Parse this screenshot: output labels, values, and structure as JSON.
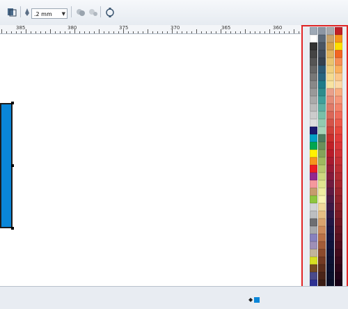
{
  "toolbar": {
    "outline_width": ".2 mm",
    "icons": [
      "arrange-icon",
      "pen-outline-icon",
      "combine-icon",
      "break-apart-icon",
      "node-icon"
    ]
  },
  "ruler": {
    "labels": [
      "385",
      "380",
      "375",
      "370",
      "365",
      "360"
    ]
  },
  "palette": {
    "columns": [
      [
        "#9ea9b6",
        "#ffffff",
        "#333333",
        "#444444",
        "#555555",
        "#666666",
        "#777777",
        "#888888",
        "#999999",
        "#aaaaaa",
        "#bbbbbb",
        "#cccccc",
        "#dddddd",
        "#1a1a6e",
        "#00a0c6",
        "#00a651",
        "#fff200",
        "#f7941d",
        "#ed1c24",
        "#92278f",
        "#f5989d",
        "#c69c6d",
        "#8dc63f",
        "#d1d3d4",
        "#bcbec0",
        "#6d6e71",
        "#a7a9ac",
        "#8781bd",
        "#9e8fb7",
        "#c2b59b",
        "#d7df23",
        "#754c24",
        "#4a4a8a",
        "#2e3192",
        "#662d91",
        "#3b5998"
      ],
      [
        "#8c96a3",
        "#5d6a79",
        "#4a5563",
        "#3f4b59",
        "#34414e",
        "#2c5a74",
        "#28657f",
        "#1f7b88",
        "#2d8c8c",
        "#3fa09b",
        "#5cb0a3",
        "#78bfa8",
        "#93cbb0",
        "#a6d4b8",
        "#4e7d60",
        "#6b8f5a",
        "#85a35a",
        "#9fb95f",
        "#b9c96f",
        "#cfd87f",
        "#e1e590",
        "#f0eda1",
        "#faf3b3",
        "#f1d89b",
        "#e6be84",
        "#d9a36e",
        "#cc8a5a",
        "#b97147",
        "#a35c38",
        "#8b4a2c",
        "#733a23",
        "#5d2e1c",
        "#4a2418",
        "#3a1c14",
        "#2c1510",
        "#200f0c"
      ],
      [
        "#a7a9ac",
        "#c9a36a",
        "#d4a04b",
        "#e0b35d",
        "#e9c46f",
        "#f0d07f",
        "#f5db90",
        "#f8e3a1",
        "#e9a08a",
        "#e48d79",
        "#df7a68",
        "#da6758",
        "#d45449",
        "#cf413a",
        "#c92e2c",
        "#c02027",
        "#b71c2a",
        "#a61b30",
        "#951b36",
        "#831b3b",
        "#701b3f",
        "#5e1a42",
        "#4c1944",
        "#3b1845",
        "#2c1745",
        "#201644",
        "#171542",
        "#12143f",
        "#0f133b",
        "#0d1237",
        "#0c1133",
        "#0b102f",
        "#0a0f2b",
        "#090e27",
        "#080d23",
        "#070c1f"
      ],
      [
        "#c02027",
        "#f7941d",
        "#ffde00",
        "#f26522",
        "#f68e56",
        "#fbaf5d",
        "#fdc689",
        "#fcd9a8",
        "#f9ad81",
        "#f7977a",
        "#f5836a",
        "#f06b5a",
        "#ec5a4b",
        "#e8483d",
        "#e23b3a",
        "#d93639",
        "#d03337",
        "#c63035",
        "#bc2d33",
        "#b12a31",
        "#a6272f",
        "#9b242d",
        "#90212b",
        "#851e29",
        "#7a1b27",
        "#6f1825",
        "#641523",
        "#591221",
        "#4e0f1f",
        "#430c1d",
        "#38091b",
        "#2d0619",
        "#220317",
        "#170015",
        "#0c0013",
        "#000011"
      ]
    ]
  }
}
